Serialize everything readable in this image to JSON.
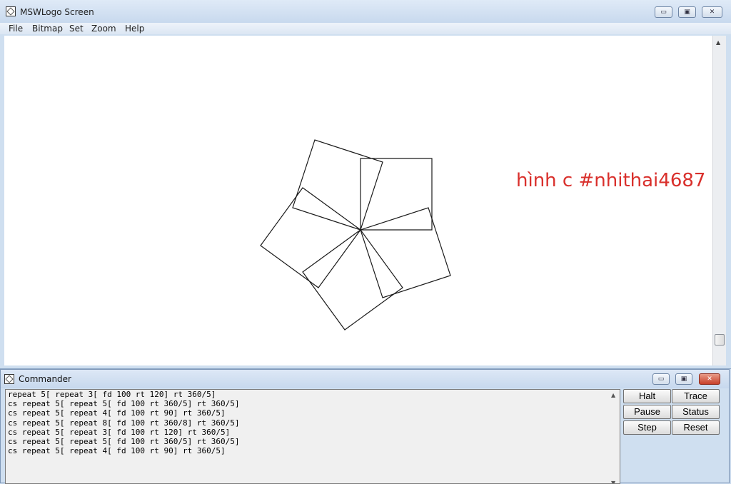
{
  "main_window": {
    "title": "MSWLogo Screen",
    "controls": {
      "minimize": "▭",
      "maximize": "▣",
      "close": "✕"
    },
    "menu": [
      "File",
      "Bitmap",
      "Set",
      "Zoom",
      "Help"
    ],
    "overlay_text": "hình c #nhithai4687",
    "overlay_color": "#d9302c"
  },
  "commander": {
    "title": "Commander",
    "controls": {
      "minimize": "▭",
      "maximize": "▣",
      "close": "✕"
    },
    "history": [
      "repeat 5[ repeat 3[ fd 100 rt 120] rt 360/5]",
      "cs repeat 5[ repeat 5[ fd 100 rt 360/5] rt 360/5]",
      "cs repeat 5[ repeat 4[ fd 100 rt 90] rt 360/5]",
      "cs repeat 5[ repeat 8[ fd 100 rt 360/8] rt 360/5]",
      "cs repeat 5[ repeat 3[ fd 100 rt 120] rt 360/5]",
      "cs repeat 5[ repeat 5[ fd 100 rt 360/5] rt 360/5]",
      "cs repeat 5[ repeat 4[ fd 100 rt 90] rt 360/5]"
    ],
    "buttons": {
      "halt": "Halt",
      "trace": "Trace",
      "pause": "Pause",
      "status": "Status",
      "step": "Step",
      "reset": "Reset"
    }
  },
  "icons": {
    "scroll_up": "▲",
    "scroll_down": "▼"
  }
}
